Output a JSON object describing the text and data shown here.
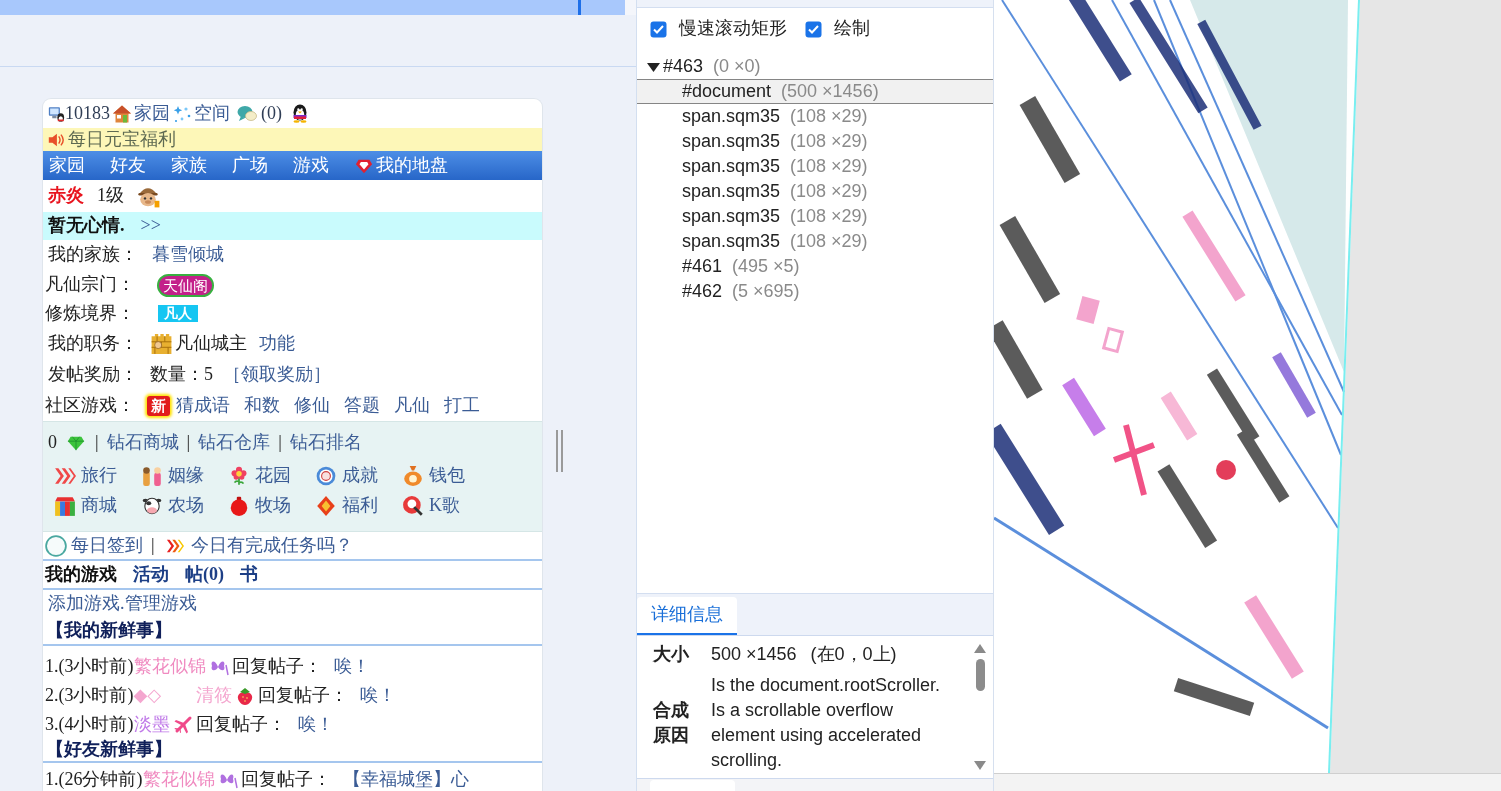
{
  "page": {
    "header": {
      "user_id": "10183",
      "links": [
        "家园",
        "空间"
      ],
      "messages": "(0)"
    },
    "notice": "每日元宝福利",
    "nav": [
      {
        "label": "家园",
        "kind": "text"
      },
      {
        "label": "好友",
        "kind": "text"
      },
      {
        "label": "家族",
        "kind": "text"
      },
      {
        "label": "广场",
        "kind": "text"
      },
      {
        "label": "游戏",
        "kind": "text"
      },
      {
        "label": "我的地盘",
        "kind": "icon"
      }
    ],
    "profile": {
      "name": "赤炎",
      "level": "1级"
    },
    "mood": {
      "text": "暂无心情.",
      "link": ">>"
    },
    "family": {
      "label": "我的家族：",
      "value": "暮雪倾城"
    },
    "sect": {
      "label": "凡仙宗门：",
      "value": "天仙阁"
    },
    "realm": {
      "label": "修炼境界：",
      "value": "凡人"
    },
    "job": {
      "label": "我的职务：",
      "value": "凡仙城主",
      "link": "功能"
    },
    "reward": {
      "label": "发帖奖励：",
      "count": "数量：5",
      "link": "［领取奖励］"
    },
    "games": {
      "label": "社区游戏：",
      "badge": "新",
      "links": [
        "猜成语",
        "和数",
        "修仙",
        "答题",
        "凡仙",
        "打工"
      ]
    },
    "diamonds": {
      "count": "0",
      "separator": "|",
      "links": [
        "钻石商城",
        "钻石仓库",
        "钻石排名"
      ]
    },
    "shortcuts": [
      "旅行",
      "姻缘",
      "花园",
      "成就",
      "钱包",
      "商城",
      "农场",
      "牧场",
      "福利",
      "K歌"
    ],
    "checkin": {
      "link": "每日签到",
      "separator": "|",
      "task": "今日有完成任务吗？"
    },
    "tabs": [
      {
        "label": "我的游戏",
        "selected": true
      },
      {
        "label": "活动",
        "selected": false
      },
      {
        "label": "帖(0)",
        "selected": false
      },
      {
        "label": "书",
        "selected": false
      }
    ],
    "game_links": "添加游戏.管理游戏",
    "feeds": [
      {
        "title": "【我的新鲜事】",
        "items": [
          {
            "prefix": "1.(3小时前)",
            "author": "繁花似锦",
            "color": "#f08ac0",
            "action": "回复帖子：",
            "content": "唉！"
          },
          {
            "prefix": "2.(3小时前)",
            "author": "◆◇ 清筱",
            "color": "#f4a6cf",
            "action": "回复帖子：",
            "content": "唉！"
          },
          {
            "prefix": "3.(4小时前)",
            "author": "淡墨",
            "color": "#c07ae8",
            "action": "回复帖子：",
            "content": "唉！"
          }
        ]
      },
      {
        "title": "【好友新鲜事】",
        "items": [
          {
            "prefix": "1.(26分钟前)",
            "author": "繁花似锦",
            "color": "#f08ac0",
            "action": "回复帖子：",
            "content": "【幸福城堡】心"
          }
        ]
      }
    ]
  },
  "layers_panel": {
    "options": [
      {
        "label": "慢速滚动矩形",
        "checked": true
      },
      {
        "label": "绘制",
        "checked": true
      }
    ],
    "tree": [
      {
        "label": "#463",
        "size": "(0 ×0)",
        "selected": false,
        "expanded": true,
        "children": [
          {
            "label": "#document",
            "size": "(500 ×1456)",
            "selected": true
          },
          {
            "label": "span.sqm35",
            "size": "(108 ×29)",
            "selected": false
          },
          {
            "label": "span.sqm35",
            "size": "(108 ×29)",
            "selected": false
          },
          {
            "label": "span.sqm35",
            "size": "(108 ×29)",
            "selected": false
          },
          {
            "label": "span.sqm35",
            "size": "(108 ×29)",
            "selected": false
          },
          {
            "label": "span.sqm35",
            "size": "(108 ×29)",
            "selected": false
          },
          {
            "label": "span.sqm35",
            "size": "(108 ×29)",
            "selected": false
          },
          {
            "label": "#461",
            "size": "(495 ×5)",
            "selected": false
          },
          {
            "label": "#462",
            "size": "(5 ×695)",
            "selected": false
          }
        ]
      }
    ]
  },
  "details_panel": {
    "tabs": [
      {
        "label": "详细信息",
        "selected": true
      }
    ],
    "size_label": "大小",
    "size_value": "500 ×1456",
    "position": "(在0，0上)",
    "reasons_label": "合成原因",
    "reasons": [
      "Is the document.rootScroller.",
      "Is a scrollable overflow element using accelerated scrolling."
    ]
  }
}
